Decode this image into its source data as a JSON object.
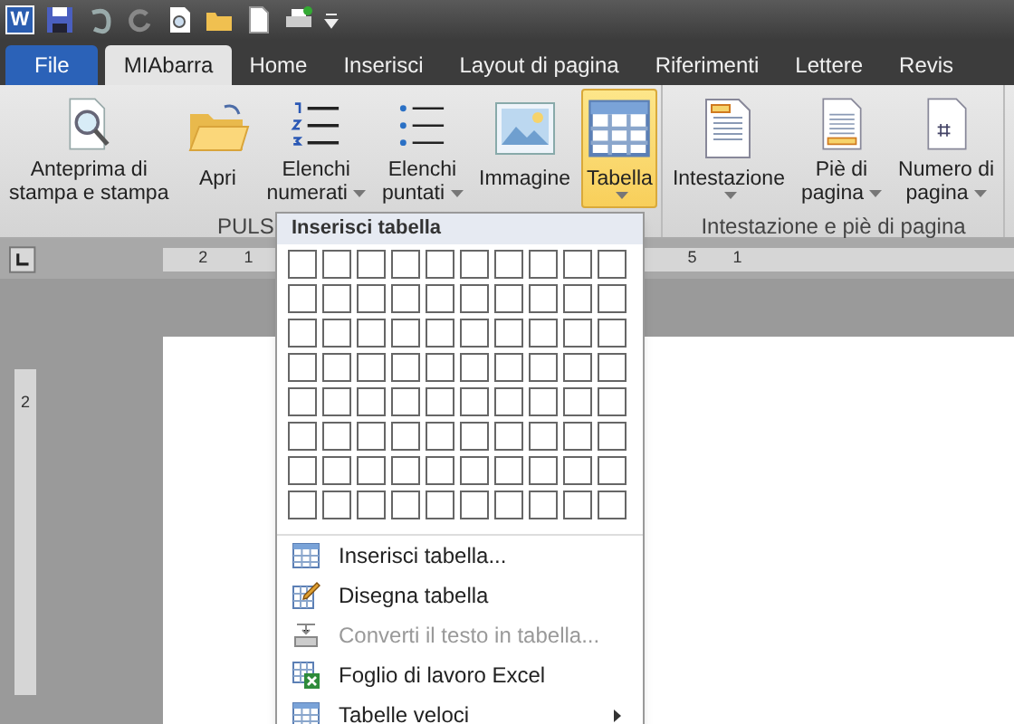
{
  "quick_access": {
    "app": "W"
  },
  "tabs": [
    {
      "label": "File",
      "kind": "file",
      "selected": false
    },
    {
      "label": "MIAbarra",
      "kind": "tab",
      "selected": true
    },
    {
      "label": "Home",
      "kind": "tab",
      "selected": false
    },
    {
      "label": "Inserisci",
      "kind": "tab",
      "selected": false
    },
    {
      "label": "Layout di pagina",
      "kind": "tab",
      "selected": false
    },
    {
      "label": "Riferimenti",
      "kind": "tab",
      "selected": false
    },
    {
      "label": "Lettere",
      "kind": "tab",
      "selected": false
    },
    {
      "label": "Revis",
      "kind": "tab",
      "selected": false
    }
  ],
  "groups": [
    {
      "label": "PULS",
      "buttons": [
        {
          "lines": [
            "Anteprima di",
            "stampa e stampa"
          ],
          "kind": "preview",
          "menu": false,
          "selected": false
        },
        {
          "lines": [
            "Apri"
          ],
          "kind": "folder",
          "menu": false,
          "selected": false
        },
        {
          "lines": [
            "Elenchi",
            "numerati"
          ],
          "kind": "numbers",
          "menu": true,
          "selected": false
        },
        {
          "lines": [
            "Elenchi",
            "puntati"
          ],
          "kind": "bullets",
          "menu": true,
          "selected": false
        },
        {
          "lines": [
            "Immagine"
          ],
          "kind": "image",
          "menu": false,
          "selected": false
        },
        {
          "lines": [
            "Tabella"
          ],
          "kind": "table",
          "menu": true,
          "selected": true
        }
      ]
    },
    {
      "label": "Intestazione e piè di pagina",
      "buttons": [
        {
          "lines": [
            "Intestazione"
          ],
          "kind": "header",
          "menu": true,
          "selected": false
        },
        {
          "lines": [
            "Piè di",
            "pagina"
          ],
          "kind": "footer",
          "menu": true,
          "selected": false
        },
        {
          "lines": [
            "Numero di",
            "pagina"
          ],
          "kind": "pagenum",
          "menu": true,
          "selected": false
        }
      ]
    }
  ],
  "ruler": {
    "left_marks": [
      "2",
      "1"
    ],
    "right_marks": [
      "5",
      "1"
    ],
    "vertical_marks": [
      "2"
    ]
  },
  "menu": {
    "title": "Inserisci tabella",
    "items": [
      {
        "label": "Inserisci tabella...",
        "kind": "insert",
        "disabled": false,
        "submenu": false
      },
      {
        "label": "Disegna tabella",
        "kind": "draw",
        "disabled": false,
        "submenu": false
      },
      {
        "label": "Converti il testo in tabella...",
        "kind": "convert",
        "disabled": true,
        "submenu": false
      },
      {
        "label": "Foglio di lavoro Excel",
        "kind": "excel",
        "disabled": false,
        "submenu": false
      },
      {
        "label": "Tabelle veloci",
        "kind": "quick",
        "disabled": false,
        "submenu": true
      }
    ]
  }
}
